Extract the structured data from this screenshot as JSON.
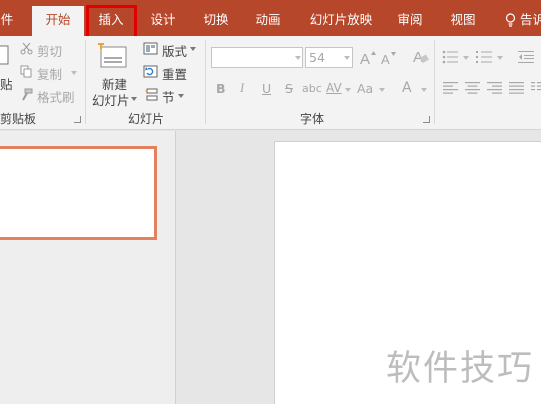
{
  "tabs": {
    "file": "件",
    "home": "开始",
    "insert": "插入",
    "design": "设计",
    "transitions": "切换",
    "animations": "动画",
    "slideshow": "幻灯片放映",
    "review": "审阅",
    "view": "视图",
    "tellme": "告诉"
  },
  "clipboard": {
    "paste_fragment": "贴",
    "cut": "剪切",
    "copy": "复制",
    "format_painter": "格式刷",
    "group_label": "剪贴板"
  },
  "slides": {
    "new_slide_line1": "新建",
    "new_slide_line2": "幻灯片",
    "layout": "版式",
    "reset": "重置",
    "section": "节",
    "group_label": "幻灯片"
  },
  "font": {
    "font_name": "",
    "font_size": "54",
    "bold": "B",
    "italic": "I",
    "underline": "U",
    "strikethrough": "S",
    "shadow": "abc",
    "spacing": "AV",
    "case": "Aa",
    "color": "A",
    "group_label": "字体"
  },
  "watermark": "软件技巧",
  "colors": {
    "accent": "#b7472a",
    "highlight_box": "#e00000",
    "thumbnail_border": "#e3815f"
  }
}
